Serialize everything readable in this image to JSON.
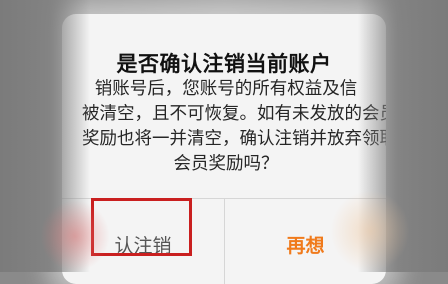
{
  "dialog": {
    "title": "是否确认注销当前账户",
    "message_lines": [
      "销账号后，您账号的所有权益及信",
      "被清空，且不可恢复。如有未发放的会员",
      "奖励也将一并清空，确认注销并放弃领取",
      "会员奖励吗？"
    ],
    "confirm_label": "认注销",
    "cancel_label": "再想",
    "confirm_color": "#555555",
    "cancel_color": "#f07a1b",
    "highlight_color": "#c91f1f"
  }
}
